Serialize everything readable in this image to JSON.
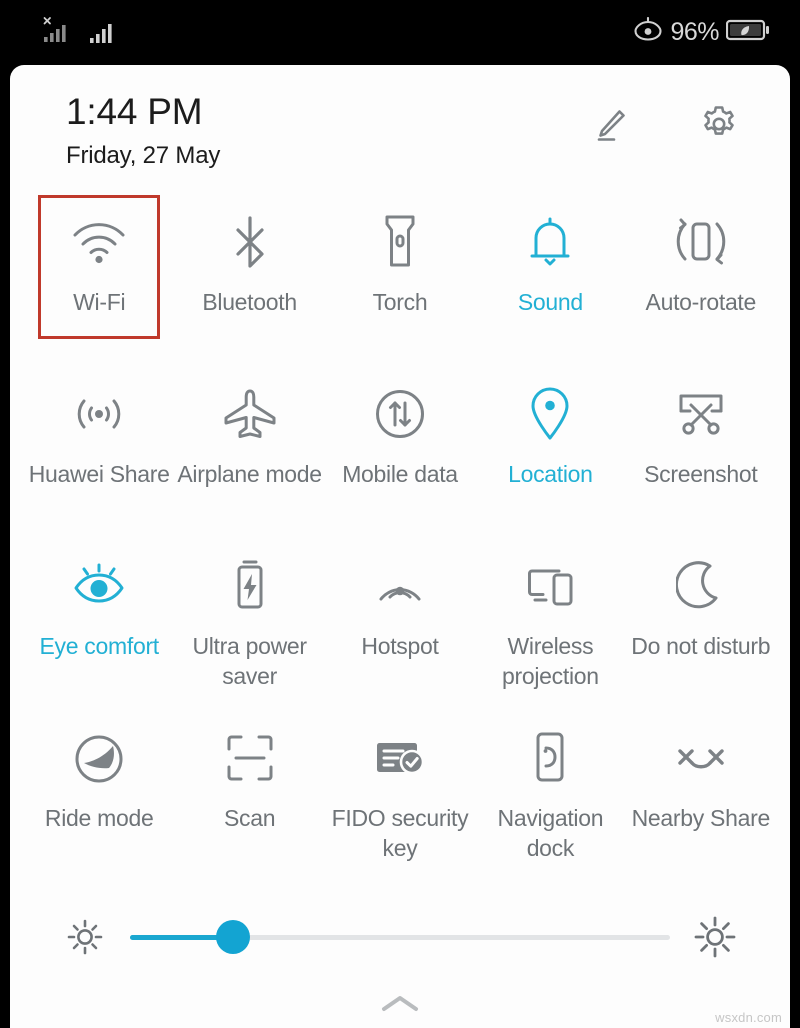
{
  "colors": {
    "accent": "#22b0d4",
    "inactive": "#6e7377",
    "highlight_box": "#c0392b",
    "panel_bg": "#fdfdfd",
    "statusbar_bg": "#000000"
  },
  "statusbar": {
    "signal_1": "signal-bars-no-service-icon",
    "signal_2": "signal-bars-icon",
    "eye_comfort_indicator": "eye-comfort-icon",
    "battery_percent": "96%",
    "battery_icon": "battery-power-saving-leaf-icon"
  },
  "header": {
    "time": "1:44 PM",
    "date": "Friday, 27 May",
    "edit_label": "edit-icon",
    "settings_label": "gear-icon"
  },
  "tiles": [
    {
      "id": "wifi",
      "label": "Wi-Fi",
      "icon": "wifi-icon",
      "active": false,
      "highlighted": true
    },
    {
      "id": "bluetooth",
      "label": "Bluetooth",
      "icon": "bluetooth-icon",
      "active": false,
      "highlighted": false
    },
    {
      "id": "torch",
      "label": "Torch",
      "icon": "flashlight-icon",
      "active": false,
      "highlighted": false
    },
    {
      "id": "sound",
      "label": "Sound",
      "icon": "bell-icon",
      "active": true,
      "highlighted": false
    },
    {
      "id": "auto-rotate",
      "label": "Auto-rotate",
      "icon": "auto-rotate-icon",
      "active": false,
      "highlighted": false
    },
    {
      "id": "huawei-share",
      "label": "Huawei Share",
      "icon": "huawei-share-icon",
      "active": false,
      "highlighted": false
    },
    {
      "id": "airplane-mode",
      "label": "Airplane mode",
      "icon": "airplane-icon",
      "active": false,
      "highlighted": false
    },
    {
      "id": "mobile-data",
      "label": "Mobile data",
      "icon": "mobile-data-icon",
      "active": false,
      "highlighted": false
    },
    {
      "id": "location",
      "label": "Location",
      "icon": "location-pin-icon",
      "active": true,
      "highlighted": false
    },
    {
      "id": "screenshot",
      "label": "Screenshot",
      "icon": "screenshot-scissors-icon",
      "active": false,
      "highlighted": false
    },
    {
      "id": "eye-comfort",
      "label": "Eye comfort",
      "icon": "eye-icon",
      "active": true,
      "highlighted": false
    },
    {
      "id": "ultra-power-saver",
      "label": "Ultra power saver",
      "icon": "battery-bolt-icon",
      "active": false,
      "highlighted": false
    },
    {
      "id": "hotspot",
      "label": "Hotspot",
      "icon": "hotspot-icon",
      "active": false,
      "highlighted": false
    },
    {
      "id": "wireless-projection",
      "label": "Wireless projection",
      "icon": "cast-screen-icon",
      "active": false,
      "highlighted": false
    },
    {
      "id": "do-not-disturb",
      "label": "Do not disturb",
      "icon": "moon-icon",
      "active": false,
      "highlighted": false
    },
    {
      "id": "ride-mode",
      "label": "Ride mode",
      "icon": "helmet-icon",
      "active": false,
      "highlighted": false
    },
    {
      "id": "scan",
      "label": "Scan",
      "icon": "scan-frame-icon",
      "active": false,
      "highlighted": false
    },
    {
      "id": "fido-security-key",
      "label": "FIDO security key",
      "icon": "fido-card-check-icon",
      "active": false,
      "highlighted": false
    },
    {
      "id": "navigation-dock",
      "label": "Navigation dock",
      "icon": "navigation-dock-icon",
      "active": false,
      "highlighted": false
    },
    {
      "id": "nearby-share",
      "label": "Nearby Share",
      "icon": "nearby-share-icon",
      "active": false,
      "highlighted": false
    }
  ],
  "brightness": {
    "low_icon": "brightness-low-icon",
    "high_icon": "brightness-high-icon",
    "value_percent": 19
  },
  "bottom": {
    "expand_icon": "chevron-up-icon",
    "watermark": "wsxdn.com"
  }
}
